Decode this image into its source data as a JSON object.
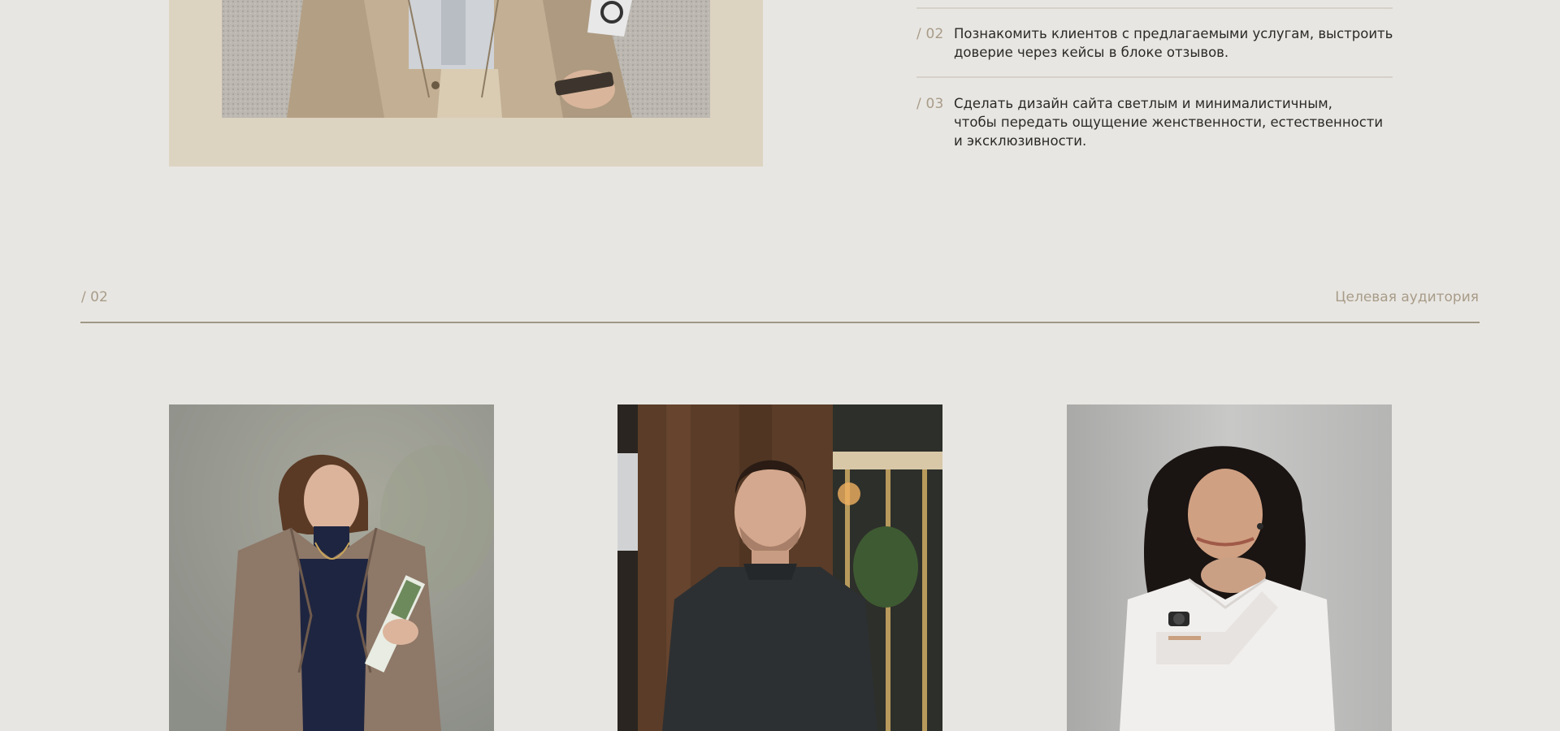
{
  "goals": [
    {
      "num": "/ 02",
      "text": "Познакомить клиентов с предлагаемыми услугам, выстроить\nдоверие через кейсы в блоке отзывов."
    },
    {
      "num": "/ 03",
      "text": "Сделать дизайн сайта светлым и минималистичным,\nчтобы передать ощущение женственности, естественности\nи эксклюзивности."
    }
  ],
  "section": {
    "number": "/ 02",
    "title": "Целевая аудитория"
  },
  "colors": {
    "page_bg": "#e8e6e2",
    "frame_beige": "#ddd3c1",
    "accent_muted": "#a89c89",
    "text_dark": "#2c2a27"
  }
}
